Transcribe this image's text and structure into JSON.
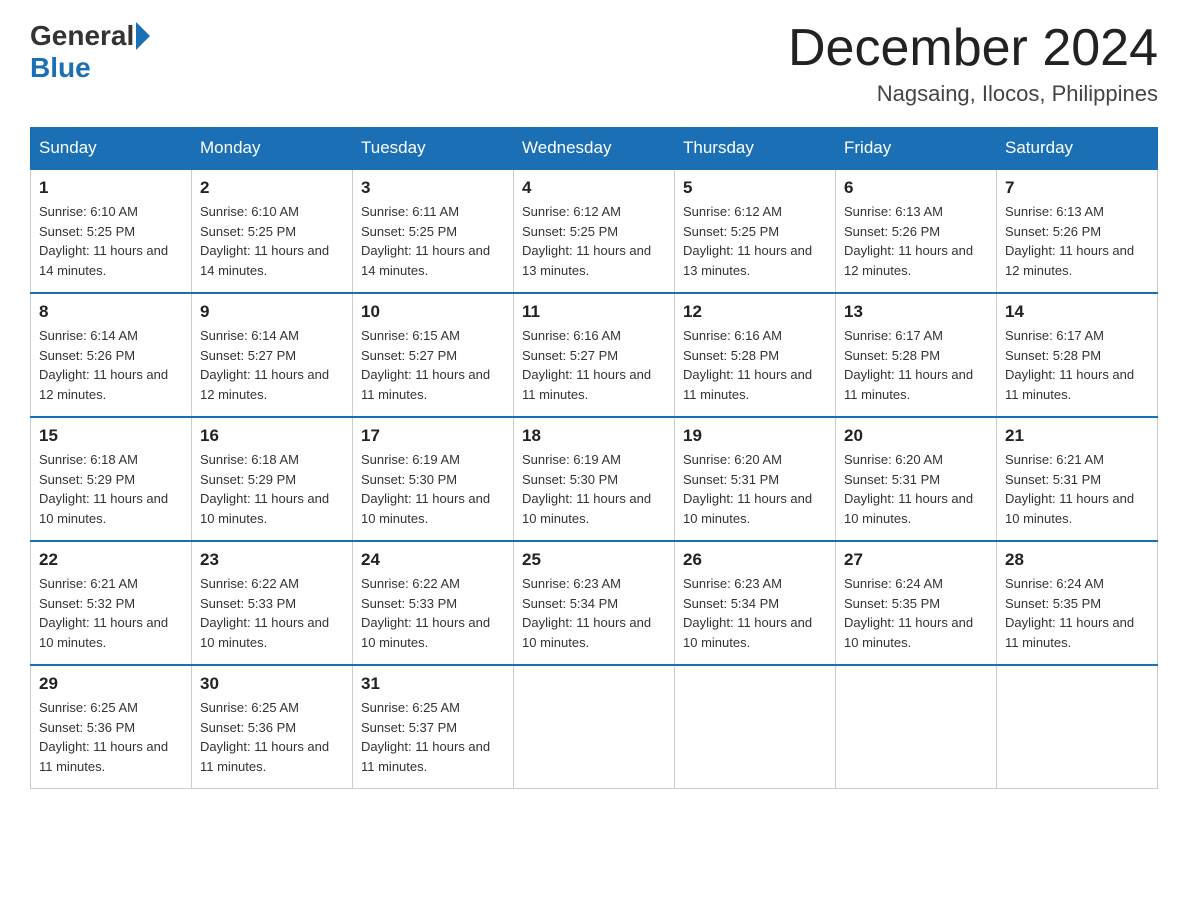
{
  "header": {
    "logo": {
      "general": "General",
      "blue": "Blue"
    },
    "title": "December 2024",
    "location": "Nagsaing, Ilocos, Philippines"
  },
  "weekdays": [
    "Sunday",
    "Monday",
    "Tuesday",
    "Wednesday",
    "Thursday",
    "Friday",
    "Saturday"
  ],
  "weeks": [
    [
      {
        "day": 1,
        "sunrise": "6:10 AM",
        "sunset": "5:25 PM",
        "daylight": "11 hours and 14 minutes."
      },
      {
        "day": 2,
        "sunrise": "6:10 AM",
        "sunset": "5:25 PM",
        "daylight": "11 hours and 14 minutes."
      },
      {
        "day": 3,
        "sunrise": "6:11 AM",
        "sunset": "5:25 PM",
        "daylight": "11 hours and 14 minutes."
      },
      {
        "day": 4,
        "sunrise": "6:12 AM",
        "sunset": "5:25 PM",
        "daylight": "11 hours and 13 minutes."
      },
      {
        "day": 5,
        "sunrise": "6:12 AM",
        "sunset": "5:25 PM",
        "daylight": "11 hours and 13 minutes."
      },
      {
        "day": 6,
        "sunrise": "6:13 AM",
        "sunset": "5:26 PM",
        "daylight": "11 hours and 12 minutes."
      },
      {
        "day": 7,
        "sunrise": "6:13 AM",
        "sunset": "5:26 PM",
        "daylight": "11 hours and 12 minutes."
      }
    ],
    [
      {
        "day": 8,
        "sunrise": "6:14 AM",
        "sunset": "5:26 PM",
        "daylight": "11 hours and 12 minutes."
      },
      {
        "day": 9,
        "sunrise": "6:14 AM",
        "sunset": "5:27 PM",
        "daylight": "11 hours and 12 minutes."
      },
      {
        "day": 10,
        "sunrise": "6:15 AM",
        "sunset": "5:27 PM",
        "daylight": "11 hours and 11 minutes."
      },
      {
        "day": 11,
        "sunrise": "6:16 AM",
        "sunset": "5:27 PM",
        "daylight": "11 hours and 11 minutes."
      },
      {
        "day": 12,
        "sunrise": "6:16 AM",
        "sunset": "5:28 PM",
        "daylight": "11 hours and 11 minutes."
      },
      {
        "day": 13,
        "sunrise": "6:17 AM",
        "sunset": "5:28 PM",
        "daylight": "11 hours and 11 minutes."
      },
      {
        "day": 14,
        "sunrise": "6:17 AM",
        "sunset": "5:28 PM",
        "daylight": "11 hours and 11 minutes."
      }
    ],
    [
      {
        "day": 15,
        "sunrise": "6:18 AM",
        "sunset": "5:29 PM",
        "daylight": "11 hours and 10 minutes."
      },
      {
        "day": 16,
        "sunrise": "6:18 AM",
        "sunset": "5:29 PM",
        "daylight": "11 hours and 10 minutes."
      },
      {
        "day": 17,
        "sunrise": "6:19 AM",
        "sunset": "5:30 PM",
        "daylight": "11 hours and 10 minutes."
      },
      {
        "day": 18,
        "sunrise": "6:19 AM",
        "sunset": "5:30 PM",
        "daylight": "11 hours and 10 minutes."
      },
      {
        "day": 19,
        "sunrise": "6:20 AM",
        "sunset": "5:31 PM",
        "daylight": "11 hours and 10 minutes."
      },
      {
        "day": 20,
        "sunrise": "6:20 AM",
        "sunset": "5:31 PM",
        "daylight": "11 hours and 10 minutes."
      },
      {
        "day": 21,
        "sunrise": "6:21 AM",
        "sunset": "5:31 PM",
        "daylight": "11 hours and 10 minutes."
      }
    ],
    [
      {
        "day": 22,
        "sunrise": "6:21 AM",
        "sunset": "5:32 PM",
        "daylight": "11 hours and 10 minutes."
      },
      {
        "day": 23,
        "sunrise": "6:22 AM",
        "sunset": "5:33 PM",
        "daylight": "11 hours and 10 minutes."
      },
      {
        "day": 24,
        "sunrise": "6:22 AM",
        "sunset": "5:33 PM",
        "daylight": "11 hours and 10 minutes."
      },
      {
        "day": 25,
        "sunrise": "6:23 AM",
        "sunset": "5:34 PM",
        "daylight": "11 hours and 10 minutes."
      },
      {
        "day": 26,
        "sunrise": "6:23 AM",
        "sunset": "5:34 PM",
        "daylight": "11 hours and 10 minutes."
      },
      {
        "day": 27,
        "sunrise": "6:24 AM",
        "sunset": "5:35 PM",
        "daylight": "11 hours and 10 minutes."
      },
      {
        "day": 28,
        "sunrise": "6:24 AM",
        "sunset": "5:35 PM",
        "daylight": "11 hours and 11 minutes."
      }
    ],
    [
      {
        "day": 29,
        "sunrise": "6:25 AM",
        "sunset": "5:36 PM",
        "daylight": "11 hours and 11 minutes."
      },
      {
        "day": 30,
        "sunrise": "6:25 AM",
        "sunset": "5:36 PM",
        "daylight": "11 hours and 11 minutes."
      },
      {
        "day": 31,
        "sunrise": "6:25 AM",
        "sunset": "5:37 PM",
        "daylight": "11 hours and 11 minutes."
      },
      null,
      null,
      null,
      null
    ]
  ]
}
